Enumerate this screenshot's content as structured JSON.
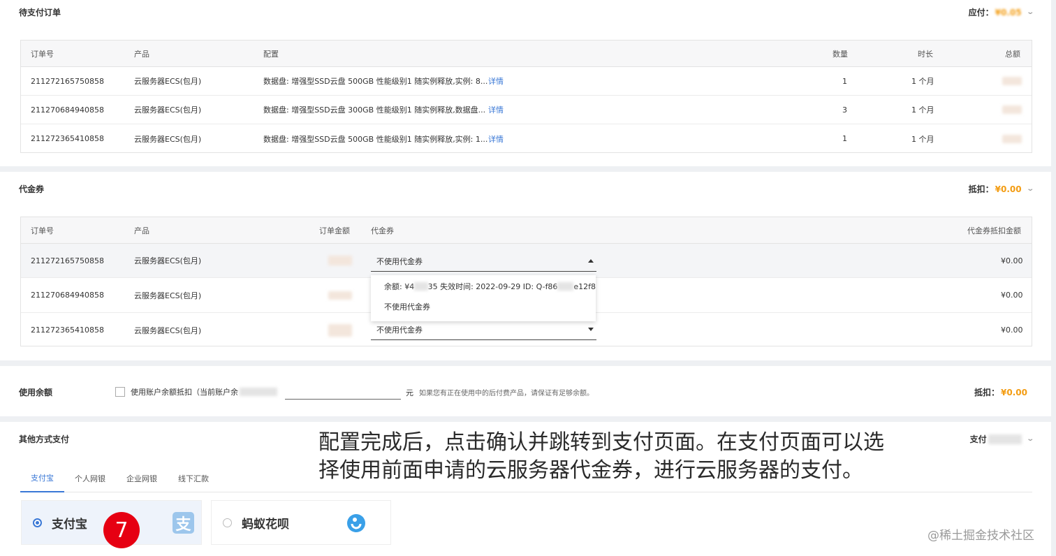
{
  "pending": {
    "title": "待支付订单",
    "payable_label": "应付：",
    "payable_amount": "¥0.05",
    "columns": [
      "订单号",
      "产品",
      "配置",
      "数量",
      "时长",
      "总额"
    ],
    "rows": [
      {
        "order": "211272165750858",
        "product": "云服务器ECS(包月)",
        "config": "数据盘: 增强型SSD云盘 500GB 性能级别1 随实例释放,实例: 8...",
        "detail": "详情",
        "qty": "1",
        "duration": "1 个月"
      },
      {
        "order": "211270684940858",
        "product": "云服务器ECS(包月)",
        "config": "数据盘: 增强型SSD云盘 300GB 性能级别1 随实例释放,数据盘...",
        "detail": "详情",
        "qty": "3",
        "duration": "1 个月"
      },
      {
        "order": "211272365410858",
        "product": "云服务器ECS(包月)",
        "config": "数据盘: 增强型SSD云盘 500GB 性能级别1 随实例释放,实例: 1...",
        "detail": "详情",
        "qty": "1",
        "duration": "1 个月"
      }
    ]
  },
  "voucher": {
    "title": "代金券",
    "deduct_label": "抵扣：",
    "deduct_amount": "¥0.00",
    "columns": [
      "订单号",
      "产品",
      "订单金额",
      "代金券",
      "代金券抵扣金额"
    ],
    "rows": [
      {
        "order": "211272165750858",
        "product": "云服务器ECS(包月)",
        "select": "不使用代金券",
        "deduct": "¥0.00"
      },
      {
        "order": "211270684940858",
        "product": "云服务器ECS(包月)",
        "select": "",
        "deduct": "¥0.00"
      },
      {
        "order": "211272365410858",
        "product": "云服务器ECS(包月)",
        "select": "不使用代金券",
        "deduct": "¥0.00"
      }
    ],
    "dropdown": {
      "option1_prefix": "余额: ¥4",
      "option1_mid": "35 失效时间: 2022-09-29 ID: Q-f86",
      "option1_suffix": "e12f8",
      "option2": "不使用代金券"
    }
  },
  "balance": {
    "title": "使用余额",
    "checkbox_label": "使用账户余额抵扣（当前账户余",
    "unit": "元",
    "note": "如果您有正在使用中的后付费产品，请保证有足够余额。",
    "deduct_label": "抵扣：",
    "deduct_amount": "¥0.00"
  },
  "other": {
    "title": "其他方式支付",
    "pay_label": "支付",
    "tabs": [
      "支付宝",
      "个人网银",
      "企业网银",
      "线下汇款"
    ],
    "methods": [
      {
        "label": "支付宝",
        "icon": "alipay-icon",
        "selected": true
      },
      {
        "label": "蚂蚁花呗",
        "icon": "huabei-icon",
        "selected": false
      }
    ]
  },
  "overlay": {
    "line1": "配置完成后，点击确认并跳转到支付页面。在支付页面可以选",
    "line2": "择使用前面申请的云服务器代金券，进行云服务器的支付。",
    "step": "7",
    "watermark": "@稀土掘金技术社区"
  },
  "colors": {
    "accent": "#3a78d6",
    "amount": "#f39c12",
    "step": "#e60012"
  }
}
